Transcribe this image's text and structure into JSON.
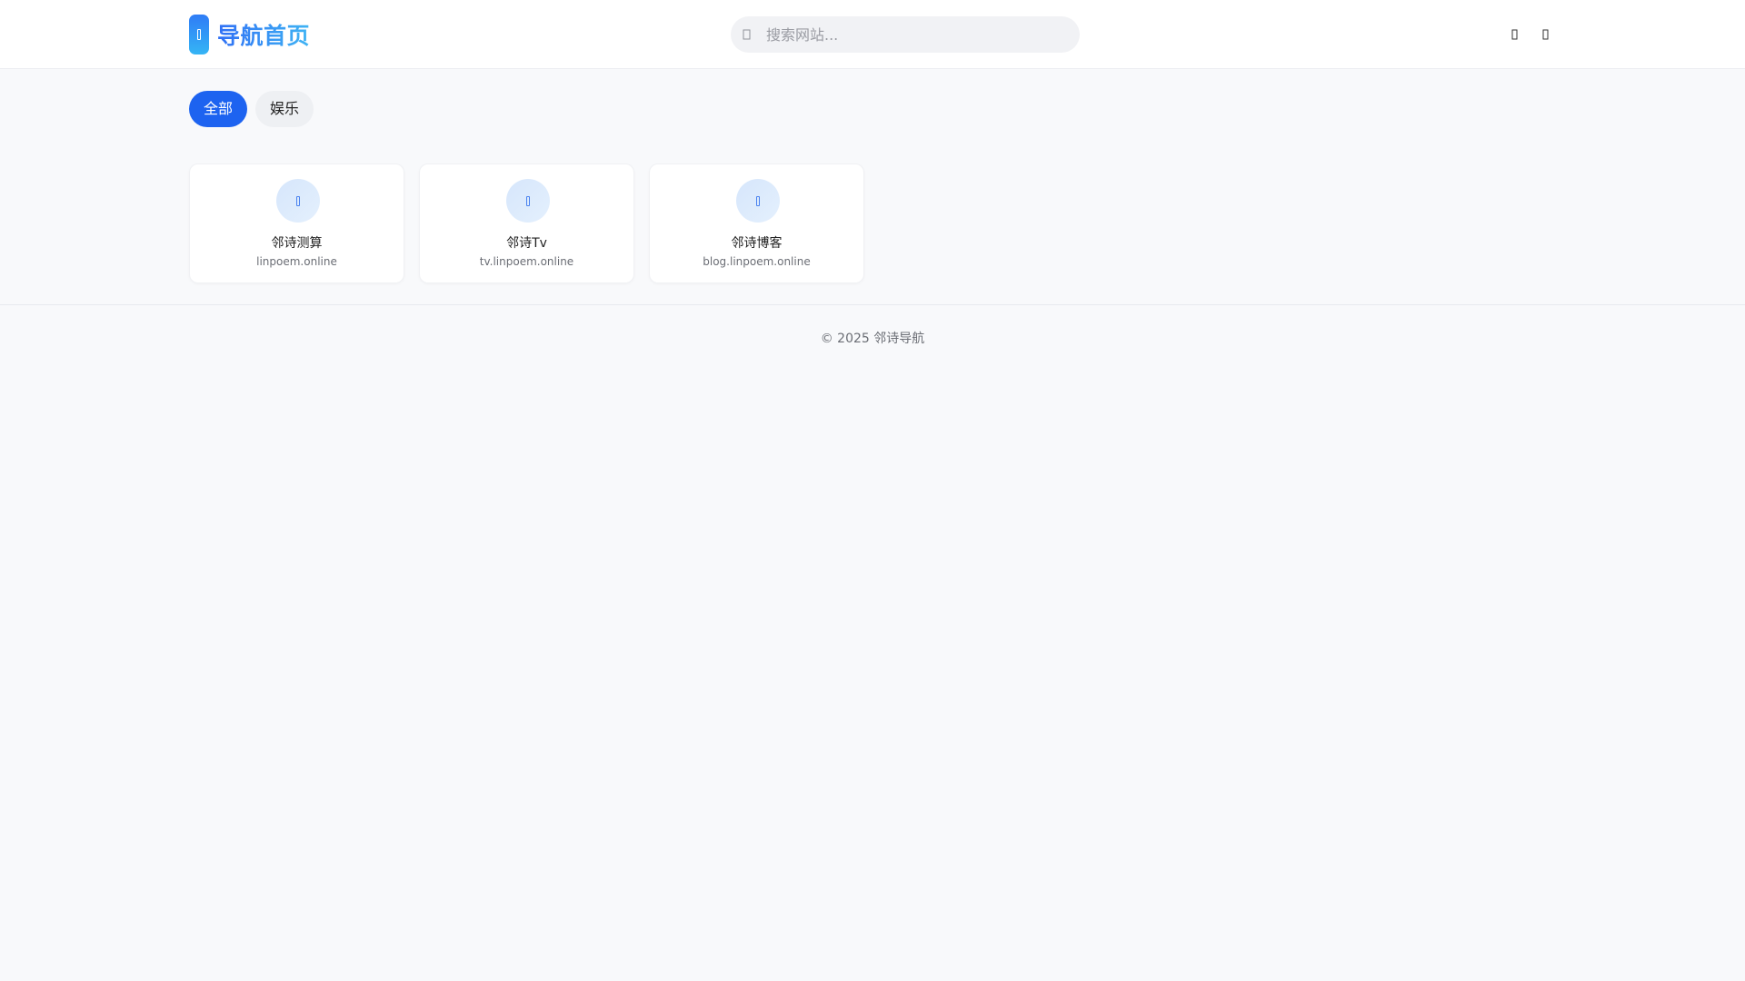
{
  "header": {
    "title": "导航首页",
    "search_placeholder": "搜索网站..."
  },
  "tabs": [
    {
      "label": "全部",
      "active": true
    },
    {
      "label": "娱乐",
      "active": false
    }
  ],
  "sites": [
    {
      "name": "邻诗测算",
      "url": "linpoem.online"
    },
    {
      "name": "邻诗Tv",
      "url": "tv.linpoem.online"
    },
    {
      "name": "邻诗博客",
      "url": "blog.linpoem.online"
    }
  ],
  "footer": {
    "text": "© 2025 邻诗导航"
  },
  "colors": {
    "accent": "#1d63f0",
    "logo_gradient_start": "#2f7cf6",
    "logo_gradient_end": "#35b5f5",
    "page_background": "#f8f9fb"
  },
  "icons": {
    "logo": "compass-icon",
    "search": "search-icon",
    "header_action_1": "theme-toggle-icon",
    "header_action_2": "menu-icon",
    "site": "globe-icon"
  }
}
